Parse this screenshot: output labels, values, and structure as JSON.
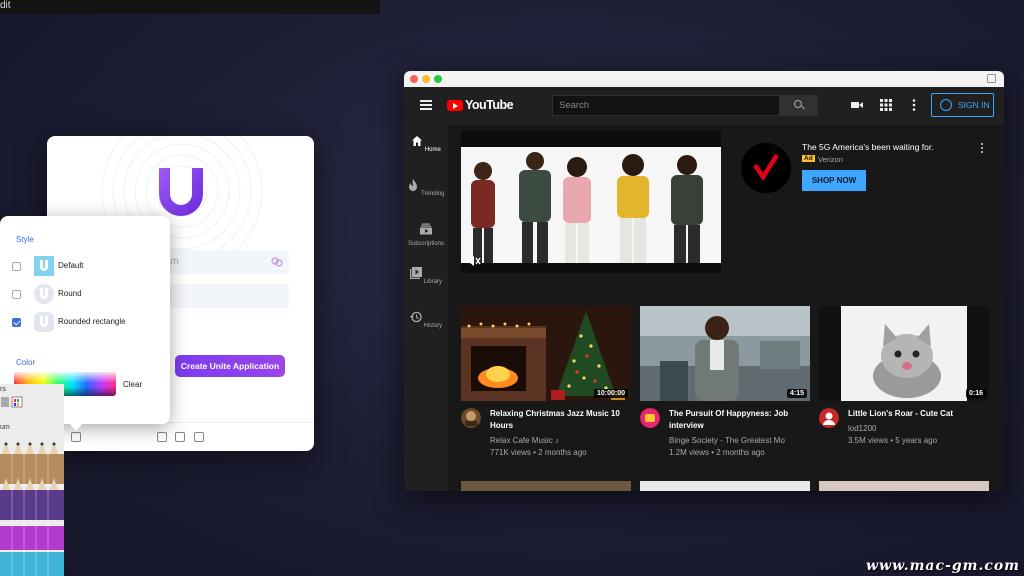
{
  "menubar": {
    "partial_text": "dit"
  },
  "unite": {
    "field1_text": "om",
    "create_button": "Create Unite Application",
    "style_popover": {
      "title": "Style",
      "options": [
        {
          "label": "Default",
          "checked": false
        },
        {
          "label": "Round",
          "checked": false
        },
        {
          "label": "Rounded rectangle",
          "checked": true
        }
      ],
      "color_title": "Color",
      "clear_label": "Clear"
    },
    "picker_labels": [
      "rs",
      "um"
    ]
  },
  "youtube": {
    "logo_text": "YouTube",
    "search_placeholder": "Search",
    "signin_label": "SIGN IN",
    "sidebar": [
      {
        "label": "Home",
        "icon": "home-icon",
        "active": true
      },
      {
        "label": "Trending",
        "icon": "trending-icon",
        "active": false
      },
      {
        "label": "Subscriptions",
        "icon": "subscriptions-icon",
        "active": false
      },
      {
        "label": "Library",
        "icon": "library-icon",
        "active": false
      },
      {
        "label": "History",
        "icon": "history-icon",
        "active": false
      }
    ],
    "ad": {
      "title": "The 5G America's been waiting for.",
      "badge": "Ad",
      "advertiser": "Verizon",
      "cta": "SHOP NOW"
    },
    "videos": [
      {
        "title": "Relaxing Christmas Jazz Music 10 Hours",
        "channel": "Relax Cafe Music ♪",
        "meta": "771K views • 2 months ago",
        "duration": "10:00:00"
      },
      {
        "title": "The Pursuit Of Happyness: Job interview",
        "channel": "Binge Society - The Greatest Mo",
        "meta": "1.2M views • 2 months ago",
        "duration": "4:15"
      },
      {
        "title": "Little Lion's Roar - Cute Cat",
        "channel": "lod1200",
        "meta": "3.5M views • 5 years ago",
        "duration": "0:16"
      }
    ],
    "colors": {
      "red": "#ff0000",
      "accent": "#3ea6ff",
      "bg": "#181818"
    }
  },
  "watermark": "www.mac-gm.com"
}
